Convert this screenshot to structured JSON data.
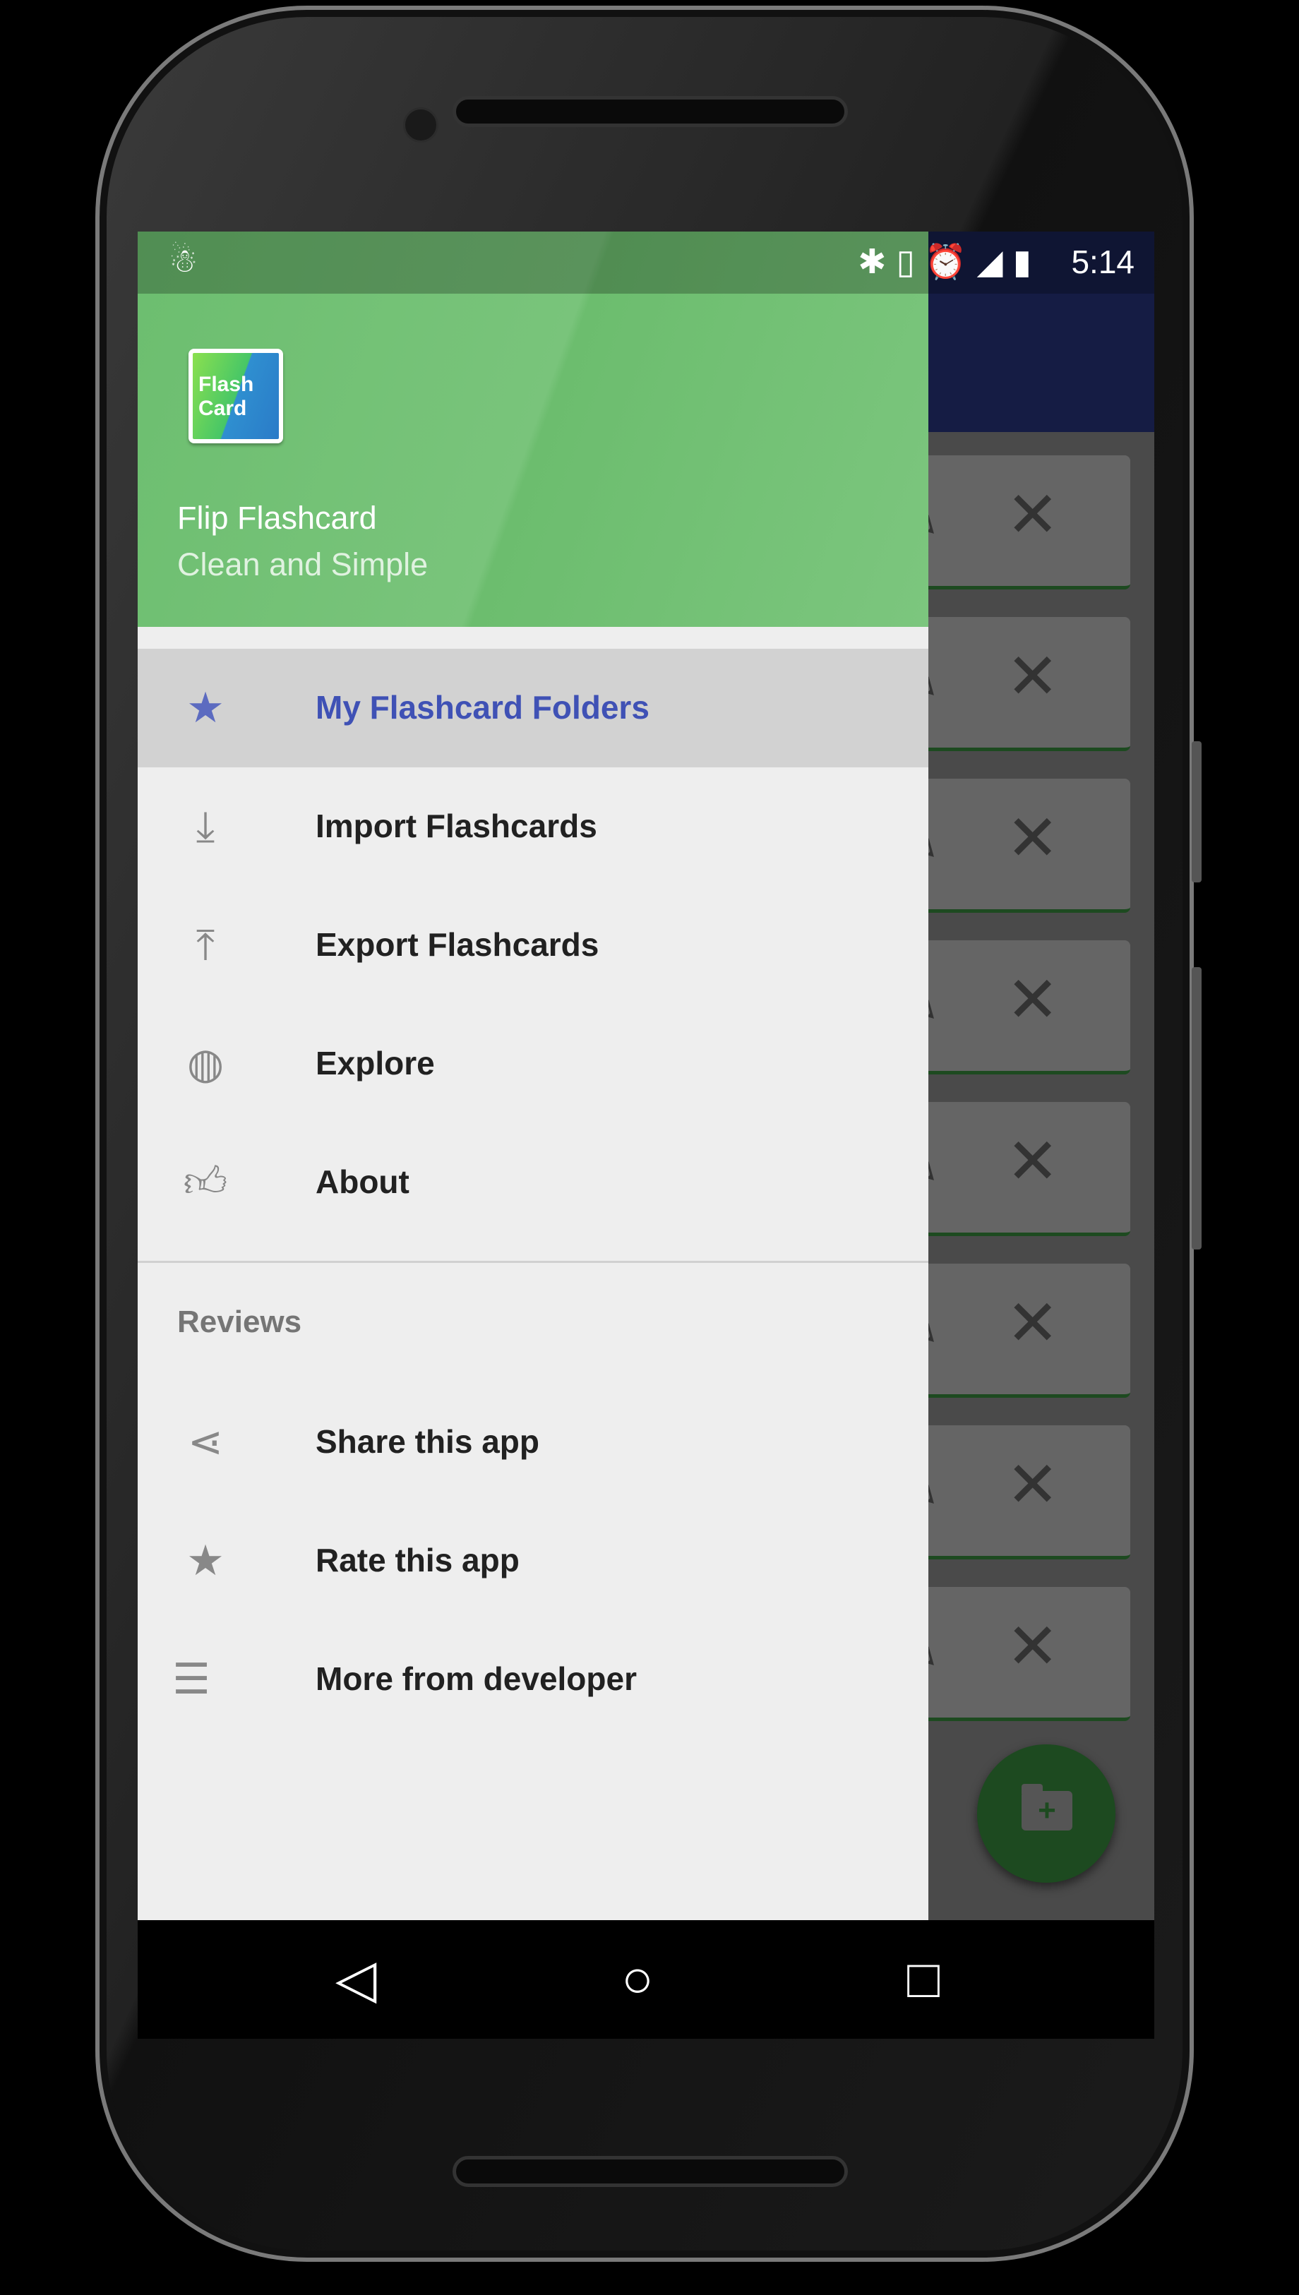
{
  "status_bar": {
    "time": "5:14",
    "icons": [
      "android-debug-icon",
      "bluetooth-icon",
      "vibrate-icon",
      "alarm-icon",
      "signal-icon",
      "battery-charging-icon"
    ]
  },
  "drawer": {
    "header": {
      "logo_text_line1": "Flash",
      "logo_text_line2": "Card",
      "title": "Flip Flashcard",
      "subtitle": "Clean and Simple",
      "color": "#72c175"
    },
    "items": [
      {
        "label": "My Flashcard Folders",
        "icon": "folder-star-icon",
        "selected": true
      },
      {
        "label": "Import Flashcards",
        "icon": "download-icon"
      },
      {
        "label": "Export Flashcards",
        "icon": "upload-icon"
      },
      {
        "label": "Explore",
        "icon": "globe-icon"
      },
      {
        "label": "About",
        "icon": "thumbs-up-icon"
      }
    ],
    "section_title": "Reviews",
    "review_items": [
      {
        "label": "Share this app",
        "icon": "share-icon"
      },
      {
        "label": "Rate this app",
        "icon": "star-icon"
      },
      {
        "label": "More from developer",
        "icon": "list-icon"
      }
    ],
    "accent": "#3f51b5"
  },
  "background": {
    "app_bar_color": "#1a237e",
    "folder_cards": 8,
    "card_actions": [
      "edit-icon",
      "delete-icon"
    ],
    "fab_icon": "create-folder-icon"
  },
  "nav_bar": [
    "back-icon",
    "home-icon",
    "recents-icon"
  ]
}
